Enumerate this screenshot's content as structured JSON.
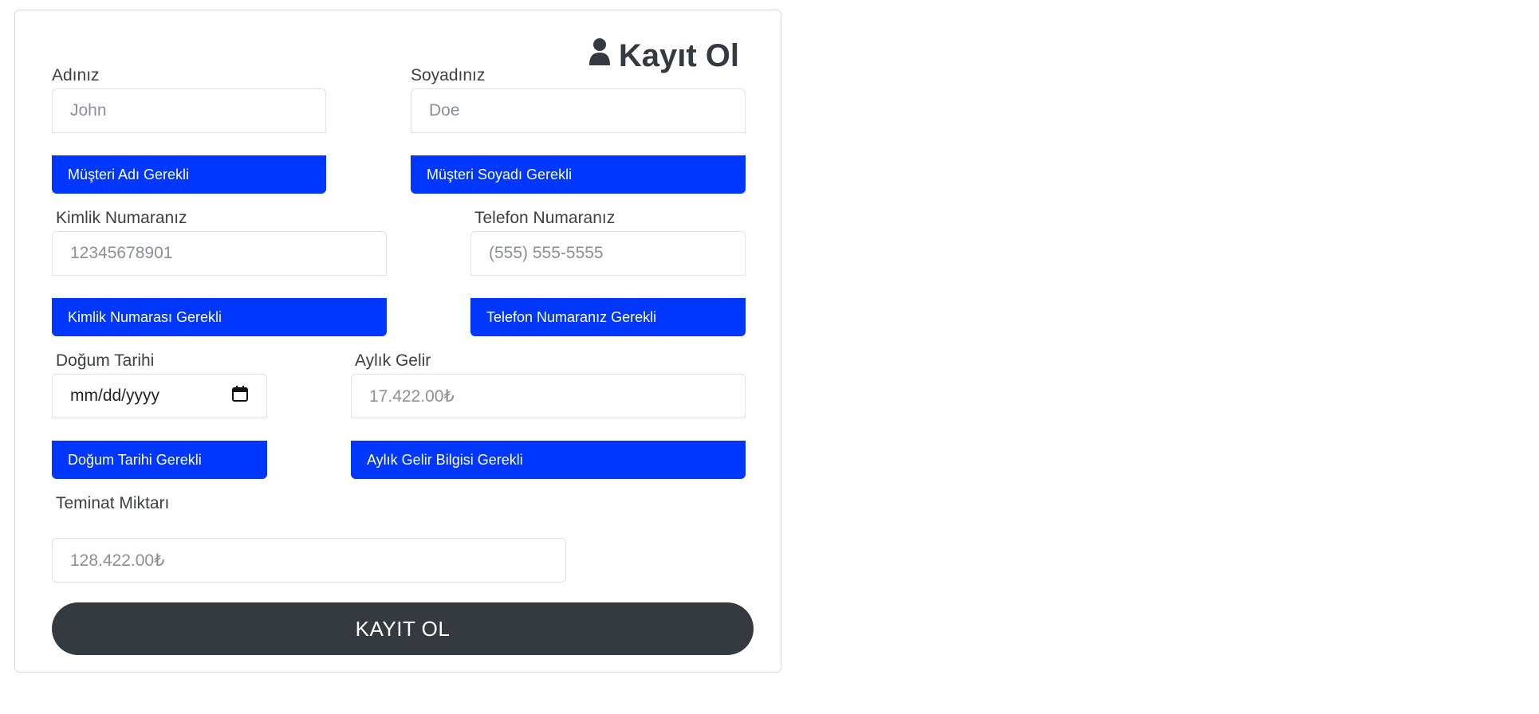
{
  "form": {
    "title": "Kayıt Ol",
    "title_icon": "user-icon",
    "fields": {
      "first_name": {
        "label": "Adınız",
        "placeholder": "John",
        "error": "Müşteri Adı Gerekli"
      },
      "last_name": {
        "label": "Soyadınız",
        "placeholder": "Doe",
        "error": "Müşteri Soyadı Gerekli"
      },
      "id_number": {
        "label": "Kimlik Numaranız",
        "placeholder": "12345678901",
        "error": "Kimlik Numarası Gerekli"
      },
      "phone": {
        "label": "Telefon Numaranız",
        "placeholder": "(555) 555-5555",
        "error": "Telefon Numaranız Gerekli"
      },
      "birth_date": {
        "label": "Doğum Tarihi",
        "placeholder": "mm/dd/yyyy",
        "error": "Doğum Tarihi Gerekli",
        "icon": "calendar-icon"
      },
      "monthly_income": {
        "label": "Aylık Gelir",
        "placeholder": "17.422.00₺",
        "error": "Aylık Gelir Bilgisi Gerekli"
      },
      "collateral": {
        "label": "Teminat Miktarı",
        "placeholder": "128.422.00₺"
      }
    },
    "submit_label": "KAYIT OL"
  },
  "colors": {
    "error_bg": "#0037ff",
    "button_bg": "#343a40",
    "title": "#343a40"
  }
}
